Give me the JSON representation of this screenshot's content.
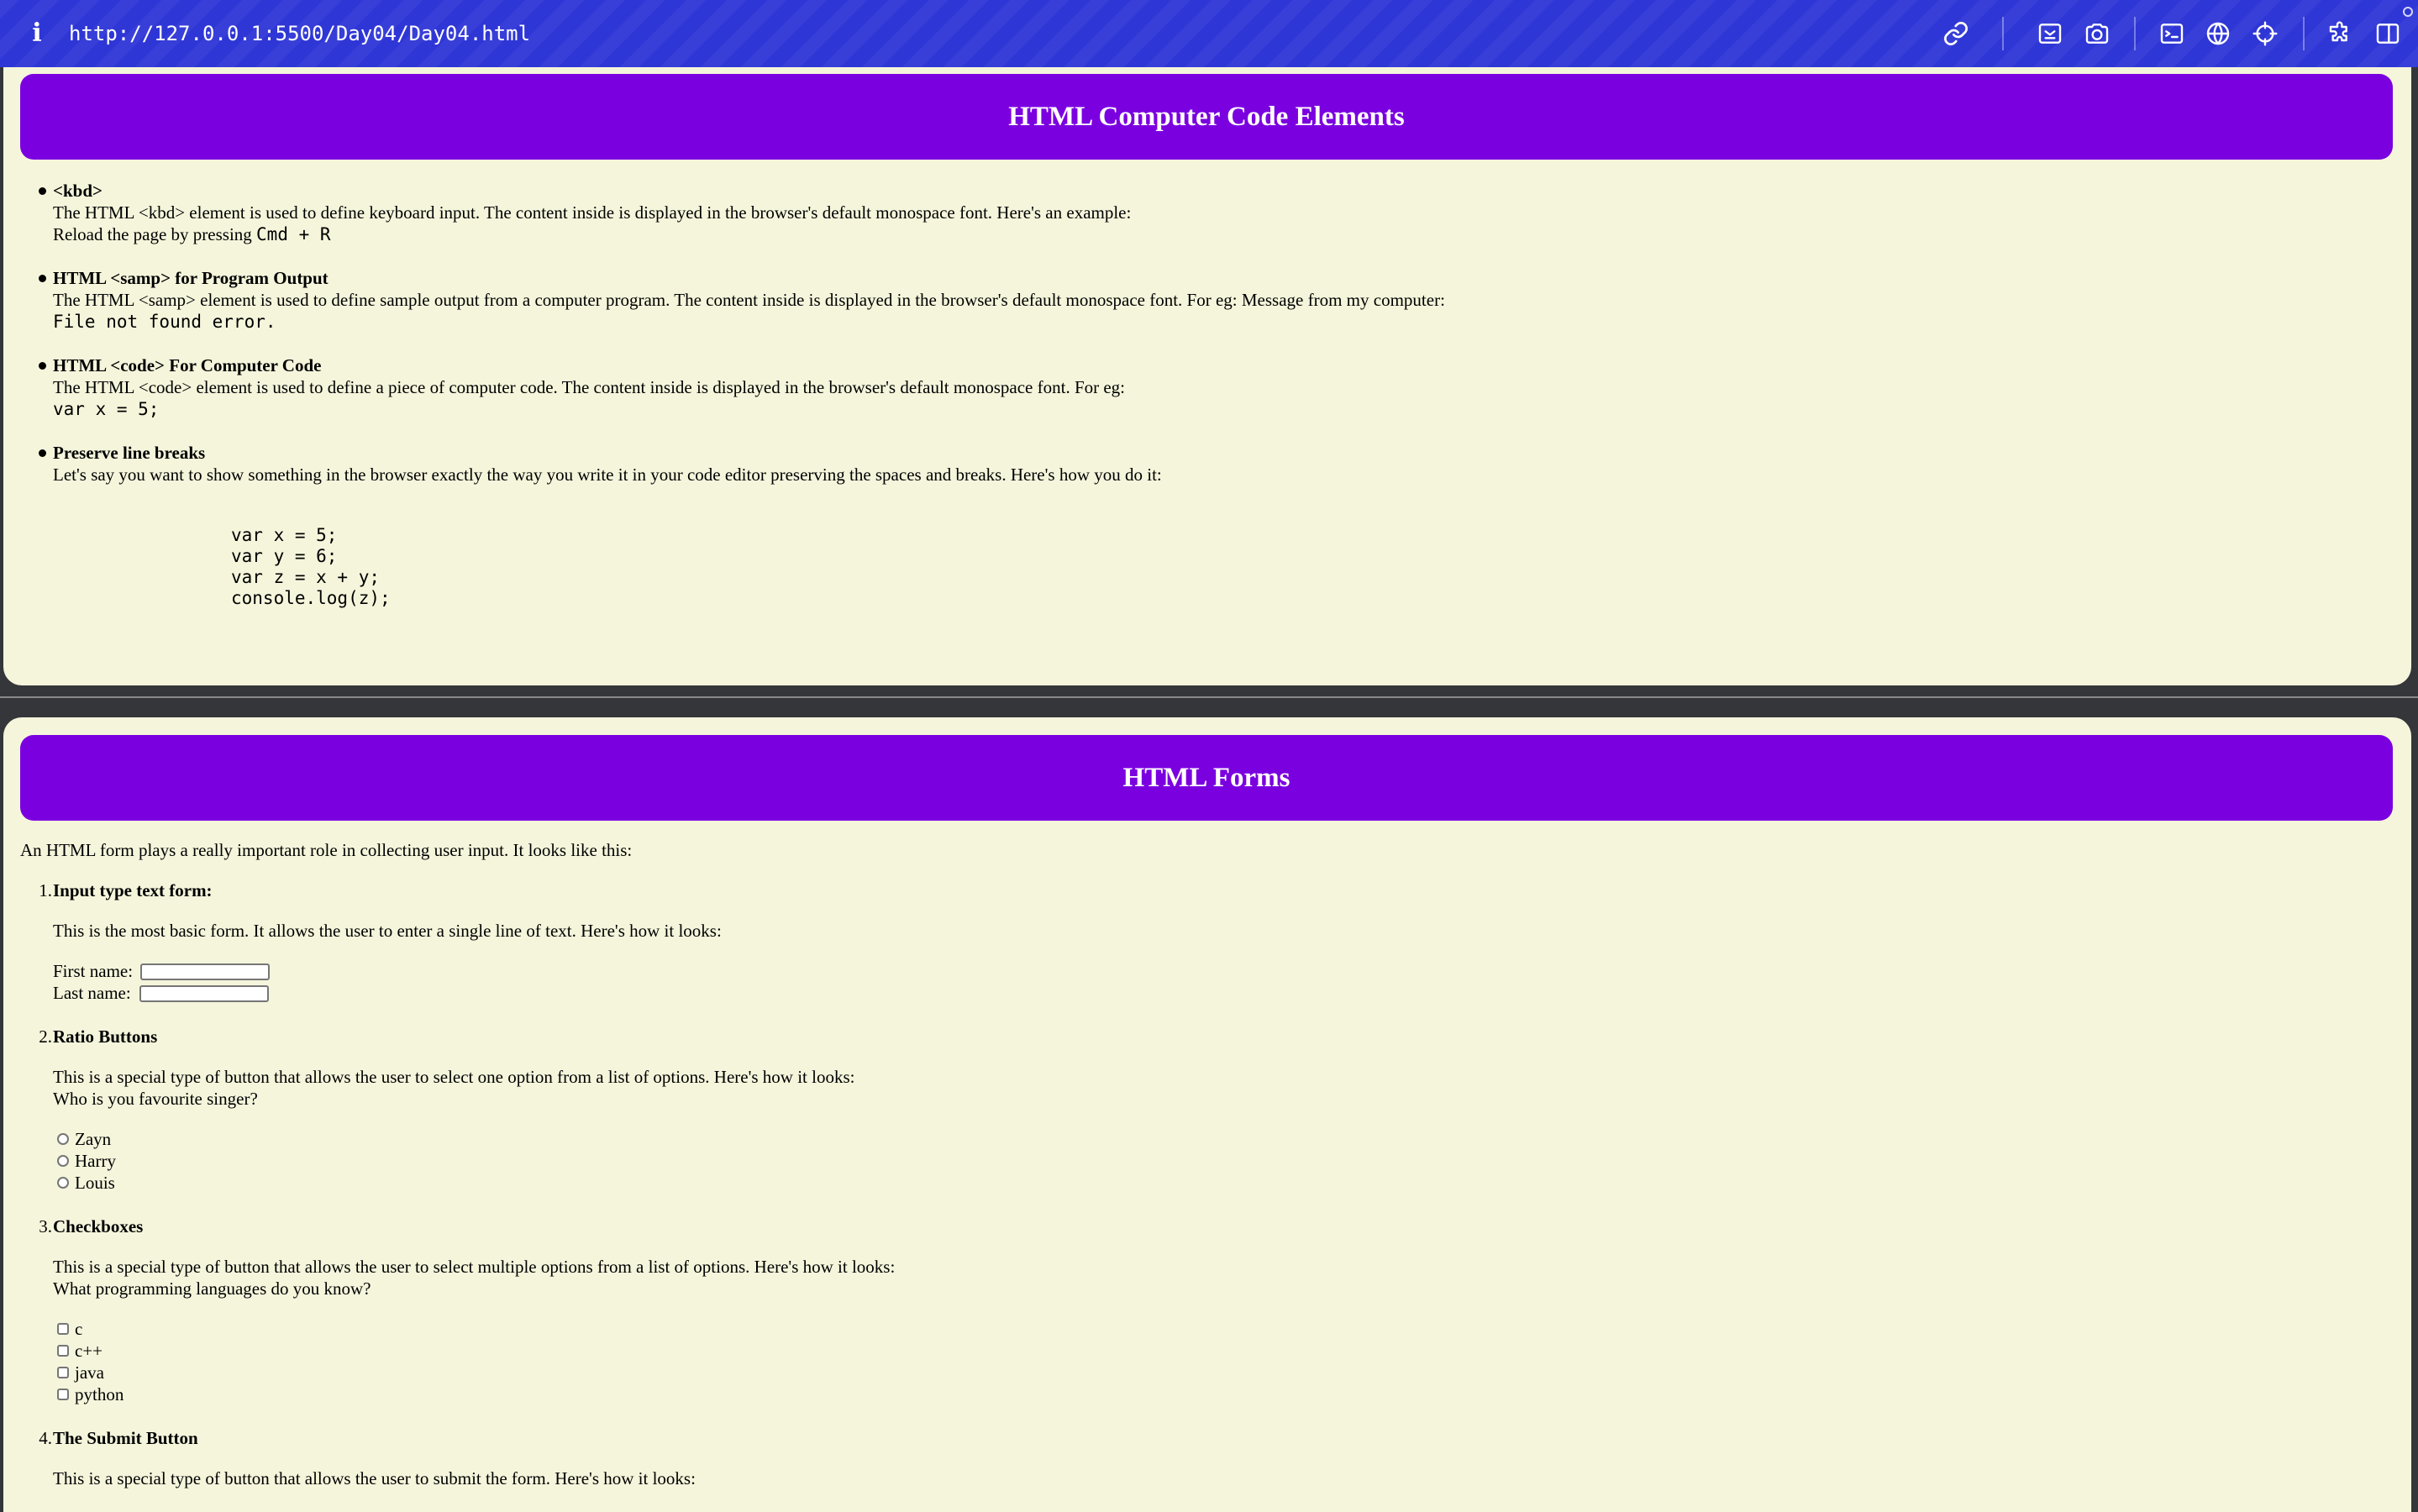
{
  "browser": {
    "url": "http://127.0.0.1:5500/Day04/Day04.html",
    "accent_color": "#2f36d6",
    "toolbar_icons": [
      "link-icon",
      "screenshot-area-icon",
      "camera-icon",
      "terminal-icon",
      "globe-icon",
      "crosshair-icon",
      "extensions-icon",
      "sidebar-toggle-icon"
    ]
  },
  "code_section": {
    "heading": "HTML Computer Code Elements",
    "heading_color": "#7b00e0",
    "items": [
      {
        "title": "<kbd>",
        "description": "The HTML <kbd> element is used to define keyboard input. The content inside is displayed in the browser's default monospace font. Here's an example:",
        "example_prefix": "Reload the page by pressing ",
        "example_code": "Cmd + R"
      },
      {
        "title": "HTML <samp> for Program Output",
        "description": "The HTML <samp> element is used to define sample output from a computer program. The content inside is displayed in the browser's default monospace font. For eg: Message from my computer:",
        "example_code": "File not found error."
      },
      {
        "title": "HTML <code> For Computer Code",
        "description": "The HTML <code> element is used to define a piece of computer code. The content inside is displayed in the browser's default monospace font. For eg:",
        "example_code": "var x = 5;"
      },
      {
        "title": "Preserve line breaks",
        "description": "Let's say you want to show something in the browser exactly the way you write it in your code editor preserving the spaces and breaks. Here's how you do it:",
        "pre_lines": [
          "var x = 5;",
          "var y = 6;",
          "var z = x + y;",
          "console.log(z);"
        ]
      }
    ]
  },
  "forms_section": {
    "heading": "HTML Forms",
    "intro": "An HTML form plays a really important role in collecting user input. It looks like this:",
    "items": [
      {
        "number": "1.",
        "title": "Input type text form:",
        "description": "This is the most basic form. It allows the user to enter a single line of text. Here's how it looks:",
        "first_name_label": "First name:",
        "first_name_value": "",
        "last_name_label": "Last name:",
        "last_name_value": ""
      },
      {
        "number": "2.",
        "title": "Ratio Buttons",
        "description": "This is a special type of button that allows the user to select one option from a list of options. Here's how it looks:",
        "question": "Who is you favourite singer?",
        "options": [
          "Zayn",
          "Harry",
          "Louis"
        ]
      },
      {
        "number": "3.",
        "title": "Checkboxes",
        "description": "This is a special type of button that allows the user to select multiple options from a list of options. Here's how it looks:",
        "question": "What programming languages do you know?",
        "options": [
          "c",
          "c++",
          "java",
          "python"
        ]
      },
      {
        "number": "4.",
        "title": "The Submit Button",
        "description": "This is a special type of button that allows the user to submit the form. Here's how it looks:"
      }
    ]
  }
}
